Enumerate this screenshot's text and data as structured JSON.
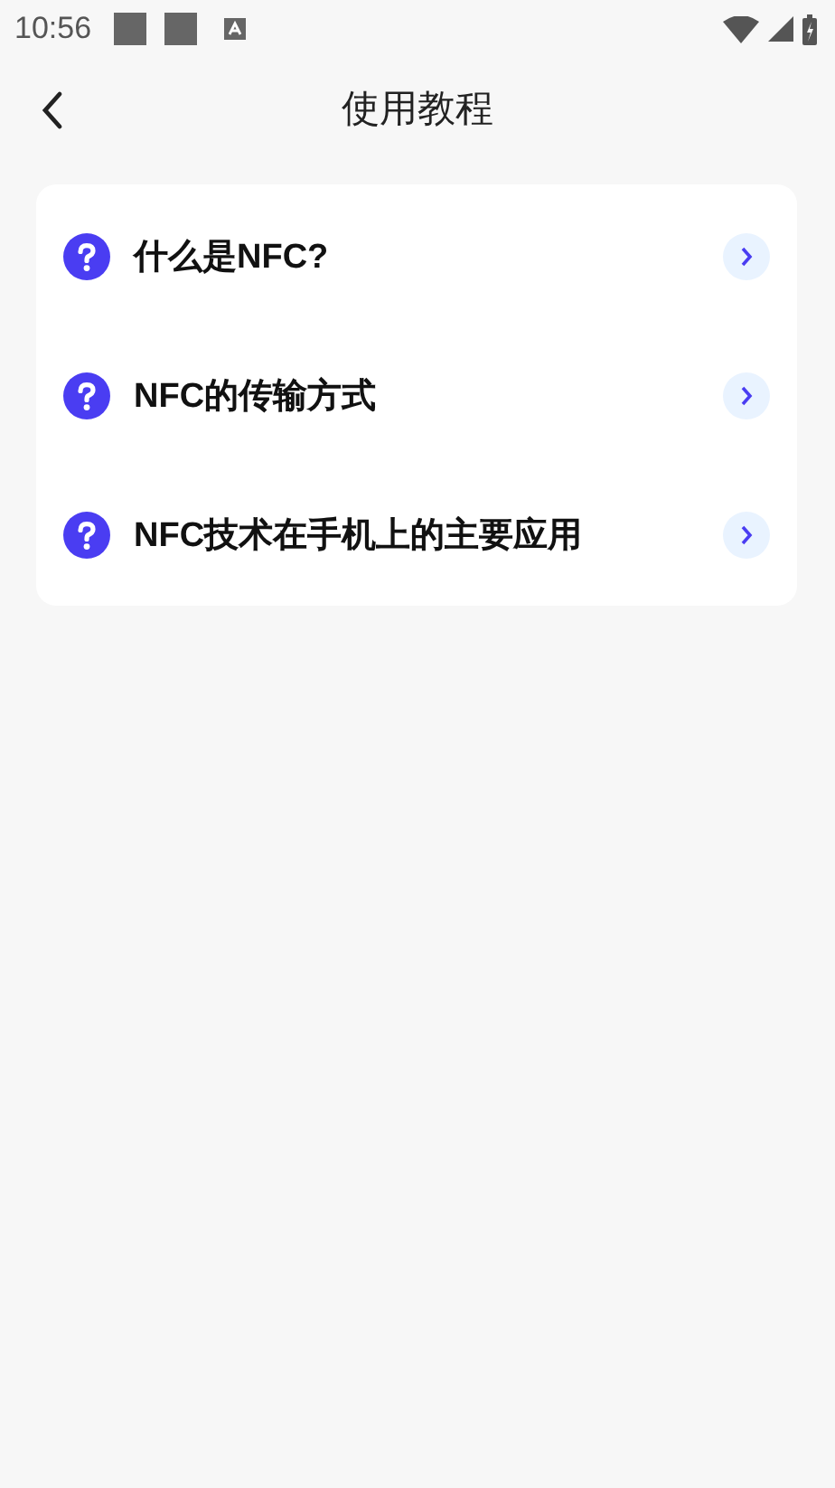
{
  "status_bar": {
    "time": "10:56"
  },
  "header": {
    "title": "使用教程"
  },
  "tutorials": [
    {
      "label": "什么是NFC?"
    },
    {
      "label": "NFC的传输方式"
    },
    {
      "label": "NFC技术在手机上的主要应用"
    }
  ]
}
